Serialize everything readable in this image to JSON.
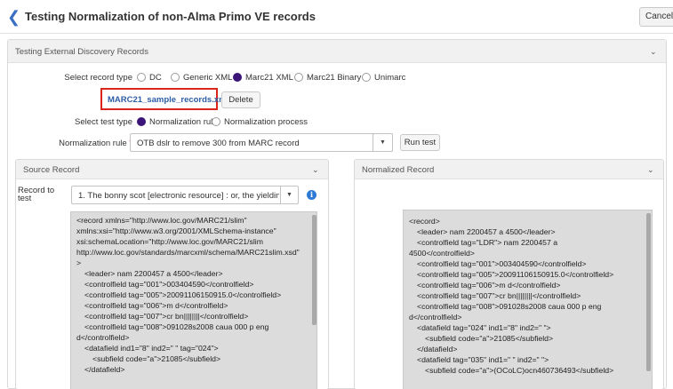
{
  "header": {
    "title": "Testing Normalization of non-Alma Primo VE records",
    "cancel_label": "Cancel"
  },
  "section": {
    "title": "Testing External Discovery Records"
  },
  "record_type": {
    "label": "Select record type",
    "options": [
      "DC",
      "Generic XML",
      "Marc21 XML",
      "Marc21 Binary",
      "Unimarc"
    ],
    "selected": "Marc21 XML"
  },
  "file": {
    "name": "MARC21_sample_records.xml",
    "delete_label": "Delete"
  },
  "test_type": {
    "label": "Select test type",
    "options": [
      "Normalization rule",
      "Normalization process"
    ],
    "selected": "Normalization rule"
  },
  "normalization_rule": {
    "label": "Normalization rule",
    "required_mark": "*",
    "value": "OTB dslr to remove 300 from MARC record",
    "run_label": "Run test"
  },
  "source": {
    "title": "Source Record",
    "record_label_1": "Record to",
    "record_label_2": "test",
    "record_value": "1. The bonny scot [electronic resource] : or, the yielding lass",
    "lines": [
      "<record xmlns=\"http://www.loc.gov/MARC21/slim\"",
      "xmlns:xsi=\"http://www.w3.org/2001/XMLSchema-instance\"",
      "xsi:schemaLocation=\"http://www.loc.gov/MARC21/slim",
      "http://www.loc.gov/standards/marcxml/schema/MARC21slim.xsd\"",
      ">",
      "<leader>   nam  2200457 a 4500</leader>",
      "<controlfield tag=\"001\">003404590</controlfield>",
      "<controlfield tag=\"005\">20091106150915.0</controlfield>",
      "<controlfield tag=\"006\">m       d</controlfield>",
      "<controlfield tag=\"007\">cr bn||||||||</controlfield>",
      "<controlfield tag=\"008\">091028s2008    caua       000 p eng",
      "d</controlfield>",
      "<datafield ind1=\"8\" ind2=\" \" tag=\"024\">",
      "<subfield code=\"a\">21085</subfield>",
      "</datafield>"
    ]
  },
  "normalized": {
    "title": "Normalized Record",
    "lines": [
      "<record>",
      "<leader>   nam  2200457 a 4500</leader>",
      "<controlfield tag=\"LDR\">   nam  2200457 a",
      "4500</controlfield>",
      "<controlfield tag=\"001\">003404590</controlfield>",
      "<controlfield tag=\"005\">20091106150915.0</controlfield>",
      "<controlfield tag=\"006\">m       d</controlfield>",
      "<controlfield tag=\"007\">cr bn||||||||</controlfield>",
      "<controlfield tag=\"008\">091028s2008    caua       000 p eng",
      "d</controlfield>",
      "<datafield tag=\"024\" ind1=\"8\" ind2=\" \">",
      "<subfield code=\"a\">21085</subfield>",
      "</datafield>",
      "<datafield tag=\"035\" ind1=\" \" ind2=\" \">",
      "<subfield code=\"a\">(OCoLC)ocn460736493</subfield>"
    ]
  },
  "colors": {
    "accent": "#3b1578",
    "link": "#2c5ea8",
    "highlight_border": "#d9251c"
  }
}
